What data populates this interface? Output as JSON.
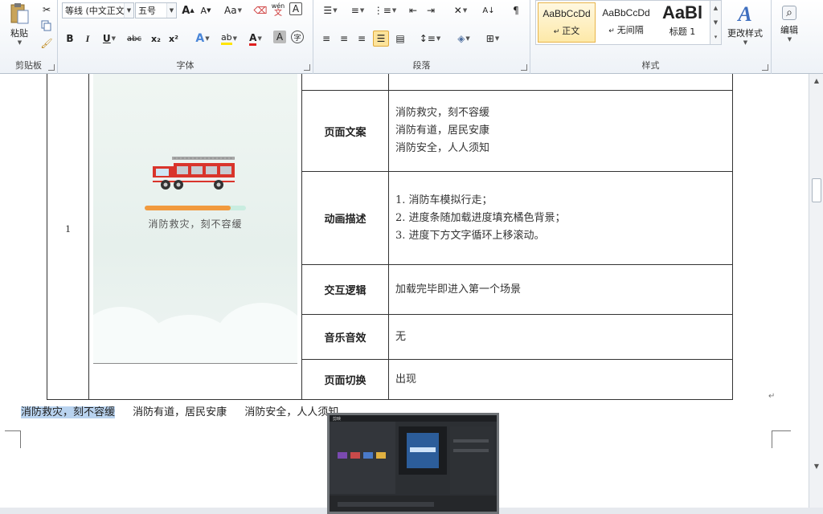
{
  "ribbon": {
    "clipboard": {
      "paste_label": "粘贴",
      "group_label": "剪贴板"
    },
    "font": {
      "font_name": "等线 (中文正文",
      "font_size": "五号",
      "bold": "B",
      "italic": "I",
      "underline": "U",
      "strike": "abc",
      "subscript": "x₂",
      "superscript": "x²",
      "grow": "A",
      "shrink": "A",
      "change_case": "Aa",
      "pinyin": "wén",
      "char_border": "A",
      "font_color": "A",
      "char_shade": "A",
      "enclose": "字",
      "group_label": "字体"
    },
    "paragraph": {
      "group_label": "段落"
    },
    "styles": {
      "items": [
        {
          "sample": "AaBbCcDd",
          "name": "正文"
        },
        {
          "sample": "AaBbCcDd",
          "name": "无间隔"
        },
        {
          "sample": "AaBl",
          "name": "标题 1"
        }
      ],
      "change_styles": "更改样式",
      "group_label": "样式"
    },
    "editing": {
      "label": "编辑"
    }
  },
  "document": {
    "row_number": "1",
    "phone_screen": {
      "loading_text": "消防救灾，刻不容缓",
      "progress": 0.85
    },
    "rows": [
      {
        "label": "页面文案",
        "lines": [
          "消防救灾，刻不容缓",
          "消防有道，居民安康",
          "消防安全，人人须知"
        ]
      },
      {
        "label": "动画描述",
        "lines": [
          "1. 消防车模拟行走；",
          "2. 进度条随加载进度填充橘色背景；",
          "3. 进度下方文字循环上移滚动。"
        ]
      },
      {
        "label": "交互逻辑",
        "lines": [
          "加载完毕即进入第一个场景"
        ]
      },
      {
        "label": "音乐音效",
        "lines": [
          "无"
        ]
      },
      {
        "label": "页面切换",
        "lines": [
          "出现"
        ]
      }
    ],
    "body_line": {
      "selected": "消防救灾，刻不容缓",
      "part2": "消防有道，居民安康",
      "part3": "消防安全，人人须知"
    },
    "para_mark": "↵"
  },
  "popup": {
    "title": "剪映"
  }
}
